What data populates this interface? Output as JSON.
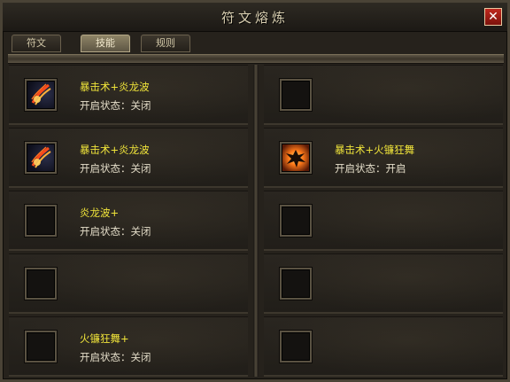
{
  "window": {
    "title": "符文熔炼",
    "close_label": "✕"
  },
  "tabs": [
    {
      "label": "符文",
      "active": false
    },
    {
      "label": "技能",
      "active": true
    },
    {
      "label": "规则",
      "active": false
    }
  ],
  "slots": {
    "left": [
      {
        "name": "暴击术+炎龙波",
        "state": "开启状态：关闭",
        "icon": "fire-slash-icon"
      },
      {
        "name": "暴击术+炎龙波",
        "state": "开启状态：关闭",
        "icon": "fire-slash-icon"
      },
      {
        "name": "炎龙波+",
        "state": "开启状态：关闭",
        "icon": null
      },
      {
        "name": "",
        "state": "",
        "icon": null
      },
      {
        "name": "火镰狂舞+",
        "state": "开启状态：关闭",
        "icon": null
      }
    ],
    "right": [
      {
        "name": "",
        "state": "",
        "icon": null
      },
      {
        "name": "暴击术+火镰狂舞",
        "state": "开启状态：开启",
        "icon": "fire-burst-icon"
      },
      {
        "name": "",
        "state": "",
        "icon": null
      },
      {
        "name": "",
        "state": "",
        "icon": null
      },
      {
        "name": "",
        "state": "",
        "icon": null
      }
    ]
  },
  "colors": {
    "skill_name": "#f0e43a",
    "state_text": "#e4ddc9",
    "active_tab": "#8e8466",
    "close_button": "#c0281e"
  }
}
